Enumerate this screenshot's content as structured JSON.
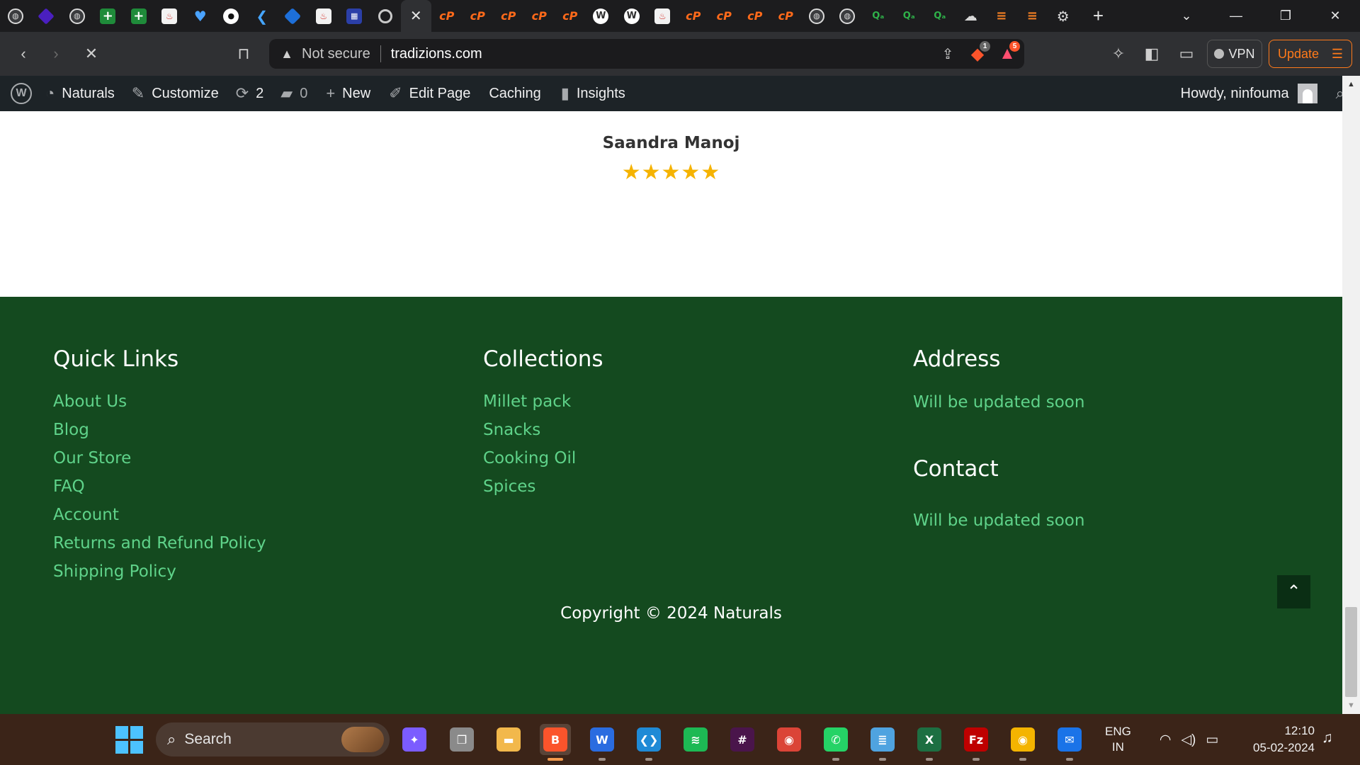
{
  "browser": {
    "tabs": [
      {
        "icon": "globe-icon",
        "glyph": "◍",
        "cls": "globe"
      },
      {
        "icon": "purple-diamond-icon",
        "glyph": "",
        "cls": "purple"
      },
      {
        "icon": "globe-icon",
        "glyph": "◍",
        "cls": "globe"
      },
      {
        "icon": "sheets-plus-icon",
        "glyph": "+",
        "cls": "green"
      },
      {
        "icon": "sheets-plus-icon",
        "glyph": "+",
        "cls": "green"
      },
      {
        "icon": "pdf-icon",
        "glyph": "♨",
        "cls": "red"
      },
      {
        "icon": "heart-icon",
        "glyph": "♥",
        "cls": "heart"
      },
      {
        "icon": "github-icon",
        "glyph": "●",
        "cls": "github"
      },
      {
        "icon": "flutter-icon",
        "glyph": "❮",
        "cls": "flutter"
      },
      {
        "icon": "blue-diamond-icon",
        "glyph": "",
        "cls": "blue"
      },
      {
        "icon": "pdf-icon",
        "glyph": "♨",
        "cls": "red"
      },
      {
        "icon": "apps-grid-icon",
        "glyph": "▦",
        "cls": "grid"
      },
      {
        "icon": "ring-icon",
        "glyph": "",
        "cls": "ring"
      },
      {
        "icon": "close-icon",
        "glyph": "✕",
        "cls": "active"
      },
      {
        "icon": "cpanel-icon",
        "glyph": "cP",
        "cls": "cp"
      },
      {
        "icon": "cpanel-icon",
        "glyph": "cP",
        "cls": "cp"
      },
      {
        "icon": "cpanel-icon",
        "glyph": "cP",
        "cls": "cp"
      },
      {
        "icon": "cpanel-icon",
        "glyph": "cP",
        "cls": "cp"
      },
      {
        "icon": "cpanel-icon",
        "glyph": "cP",
        "cls": "cp"
      },
      {
        "icon": "wordpress-icon",
        "glyph": "W",
        "cls": "wp"
      },
      {
        "icon": "wordpress-icon",
        "glyph": "W",
        "cls": "wp"
      },
      {
        "icon": "pdf-icon",
        "glyph": "♨",
        "cls": "red"
      },
      {
        "icon": "cpanel-icon",
        "glyph": "cP",
        "cls": "cp"
      },
      {
        "icon": "cpanel-icon",
        "glyph": "cP",
        "cls": "cp"
      },
      {
        "icon": "cpanel-icon",
        "glyph": "cP",
        "cls": "cp"
      },
      {
        "icon": "cpanel-icon",
        "glyph": "cP",
        "cls": "cp"
      },
      {
        "icon": "globe-icon",
        "glyph": "◍",
        "cls": "globe"
      },
      {
        "icon": "globe-icon",
        "glyph": "◍",
        "cls": "globe"
      },
      {
        "icon": "qa-icon",
        "glyph": "Qₐ",
        "cls": "q"
      },
      {
        "icon": "qa-icon",
        "glyph": "Qₐ",
        "cls": "q"
      },
      {
        "icon": "qa-icon",
        "glyph": "Qₐ",
        "cls": "q"
      },
      {
        "icon": "cloud-icon",
        "glyph": "☁",
        "cls": "cloud"
      },
      {
        "icon": "stackoverflow-icon",
        "glyph": "≡",
        "cls": "so"
      },
      {
        "icon": "stackoverflow-icon",
        "glyph": "≡",
        "cls": "so"
      },
      {
        "icon": "settings-icon",
        "glyph": "⚙",
        "cls": "gear"
      }
    ],
    "new_tab_glyph": "+",
    "window_controls": {
      "tab_search": "⌄",
      "minimize": "—",
      "restore": "❐",
      "close": "✕"
    },
    "nav": {
      "back": "‹",
      "forward": "›",
      "stop": "✕",
      "bookmark": "⊓"
    },
    "security_label": "Not secure",
    "url": "tradizions.com",
    "brave_shields_badge": "1",
    "rewards_badge": "5",
    "vpn_label": "VPN",
    "update_label": "Update"
  },
  "admin_bar": {
    "site_name": "Naturals",
    "customize": "Customize",
    "updates_count": "2",
    "comments_count": "0",
    "new_label": "New",
    "edit_page": "Edit Page",
    "caching": "Caching",
    "insights": "Insights",
    "howdy": "Howdy, ninfouma"
  },
  "review": {
    "reviewer_name": "Saandra Manoj",
    "rating": 5,
    "stars": "★★★★★"
  },
  "footer": {
    "quick_links": {
      "heading": "Quick Links",
      "items": [
        "About Us",
        "Blog",
        "Our Store",
        "FAQ",
        "Account",
        "Returns and Refund Policy",
        "Shipping Policy"
      ]
    },
    "collections": {
      "heading": "Collections",
      "items": [
        "Millet pack",
        "Snacks",
        "Cooking Oil",
        "Spices"
      ]
    },
    "address": {
      "heading": "Address",
      "text": "Will be updated soon"
    },
    "contact": {
      "heading": "Contact",
      "text": "Will be updated soon"
    },
    "copyright": "Copyright © 2024 Naturals",
    "back_to_top": "⌃"
  },
  "colors": {
    "footer_bg": "#144a1f",
    "footer_link": "#5fd38a",
    "star": "#f5b301",
    "update_accent": "#ff7a1a"
  },
  "taskbar": {
    "search_label": "Search",
    "apps": [
      {
        "name": "copilot-icon",
        "glyph": "✦",
        "bg": "#7b5cff",
        "active": false,
        "dot": false
      },
      {
        "name": "task-view-icon",
        "glyph": "❐",
        "bg": "#8a8a8a",
        "active": false,
        "dot": false
      },
      {
        "name": "file-explorer-icon",
        "glyph": "▬",
        "bg": "#f2b84b",
        "active": false,
        "dot": false
      },
      {
        "name": "brave-icon",
        "glyph": "B",
        "bg": "#fb542b",
        "active": true,
        "dot": true
      },
      {
        "name": "app-w-icon",
        "glyph": "W",
        "bg": "#2a6ce0",
        "active": false,
        "dot": true
      },
      {
        "name": "vscode-icon",
        "glyph": "❮❯",
        "bg": "#1f8ad6",
        "active": false,
        "dot": true
      },
      {
        "name": "spotify-icon",
        "glyph": "≋",
        "bg": "#1db954",
        "active": false,
        "dot": false
      },
      {
        "name": "slack-icon",
        "glyph": "#",
        "bg": "#4a154b",
        "active": false,
        "dot": false
      },
      {
        "name": "chrome-icon",
        "glyph": "◉",
        "bg": "#db4437",
        "active": false,
        "dot": false
      },
      {
        "name": "whatsapp-icon",
        "glyph": "✆",
        "bg": "#25d366",
        "active": false,
        "dot": true
      },
      {
        "name": "notepad-icon",
        "glyph": "≣",
        "bg": "#4fa3e0",
        "active": false,
        "dot": true
      },
      {
        "name": "excel-icon",
        "glyph": "X",
        "bg": "#1d6f42",
        "active": false,
        "dot": true
      },
      {
        "name": "filezilla-icon",
        "glyph": "Fz",
        "bg": "#bf0000",
        "active": false,
        "dot": true
      },
      {
        "name": "chrome-icon",
        "glyph": "◉",
        "bg": "#f4b400",
        "active": false,
        "dot": true
      },
      {
        "name": "mail-icon",
        "glyph": "✉",
        "bg": "#1a73e8",
        "active": false,
        "dot": true
      }
    ],
    "language": "ENG",
    "region": "IN",
    "time": "12:10",
    "date": "05-02-2024"
  }
}
